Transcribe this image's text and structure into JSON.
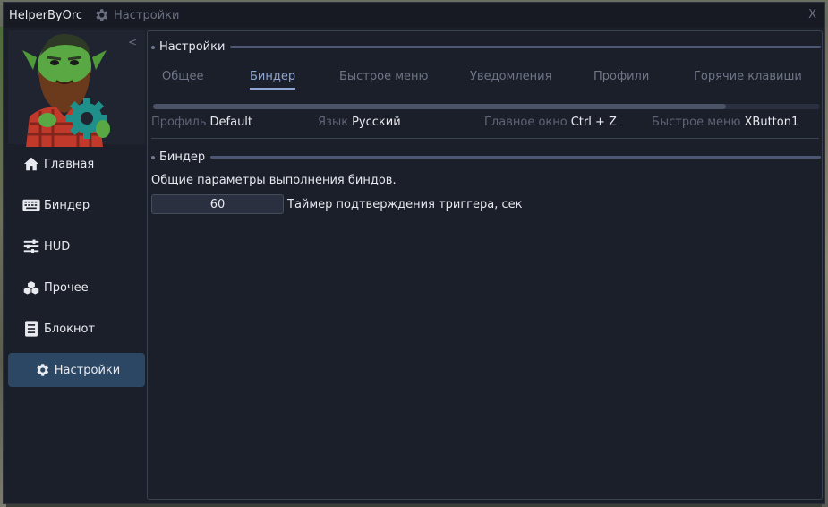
{
  "window": {
    "app_title": "HelperByOrc",
    "current_section": "Настройки",
    "close_label": "X",
    "collapse_label": "<"
  },
  "sidebar": {
    "items": [
      {
        "label": "Главная",
        "icon": "home-icon",
        "active": false
      },
      {
        "label": "Биндер",
        "icon": "keyboard-icon",
        "active": false
      },
      {
        "label": "HUD",
        "icon": "sliders-icon",
        "active": false
      },
      {
        "label": "Прочее",
        "icon": "cubes-icon",
        "active": false
      },
      {
        "label": "Блокнот",
        "icon": "notebook-icon",
        "active": false
      },
      {
        "label": "Настройки",
        "icon": "gear-icon",
        "active": true
      }
    ]
  },
  "main": {
    "header": "Настройки",
    "tabs": [
      {
        "label": "Общее",
        "active": false
      },
      {
        "label": "Биндер",
        "active": true
      },
      {
        "label": "Быстрое меню",
        "active": false
      },
      {
        "label": "Уведомления",
        "active": false
      },
      {
        "label": "Профили",
        "active": false
      },
      {
        "label": "Горячие клавиши",
        "active": false
      }
    ],
    "info": [
      {
        "key": "Профиль",
        "value": "Default"
      },
      {
        "key": "Язык",
        "value": "Русский"
      },
      {
        "key": "Главное окно",
        "value": "Ctrl + Z"
      },
      {
        "key": "Быстрое меню",
        "value": "XButton1"
      }
    ],
    "binder_section": {
      "header": "Биндер",
      "description": "Общие параметры выполнения биндов.",
      "trigger_timer_value": "60",
      "trigger_timer_label": "Таймер подтверждения триггера, сек"
    }
  },
  "colors": {
    "window_bg": "#1b1f2a",
    "accent": "#8fa5d6",
    "active_nav_bg": "#2c4763",
    "muted_text": "#6f7587"
  }
}
